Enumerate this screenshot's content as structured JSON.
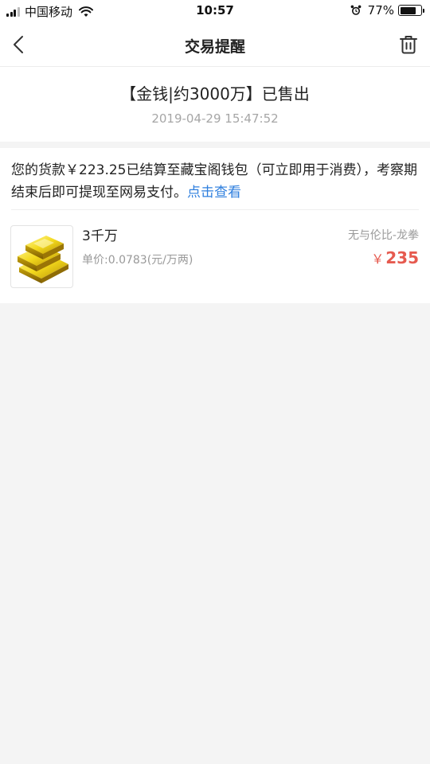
{
  "status_bar": {
    "carrier": "中国移动",
    "time": "10:57",
    "battery_percent": "77%",
    "battery_level": 0.77
  },
  "nav": {
    "title": "交易提醒",
    "back_icon": "chevron-left-icon",
    "delete_icon": "trash-icon"
  },
  "order": {
    "title": "【金钱|约3000万】已售出",
    "time": "2019-04-29 15:47:52"
  },
  "notice": {
    "text": "您的货款￥223.25已结算至藏宝阁钱包（可立即用于消费），考察期结束后即可提现至网易支付。",
    "link": "点击查看"
  },
  "item": {
    "name": "3千万",
    "unit_price": "单价:0.0783(元/万两)",
    "server": "无与伦比-龙拳",
    "currency": "￥",
    "price": "235",
    "image_icon": "gold-bars-icon"
  },
  "colors": {
    "link": "#2f7fde",
    "price": "#e65a4f",
    "background": "#f4f4f4"
  }
}
